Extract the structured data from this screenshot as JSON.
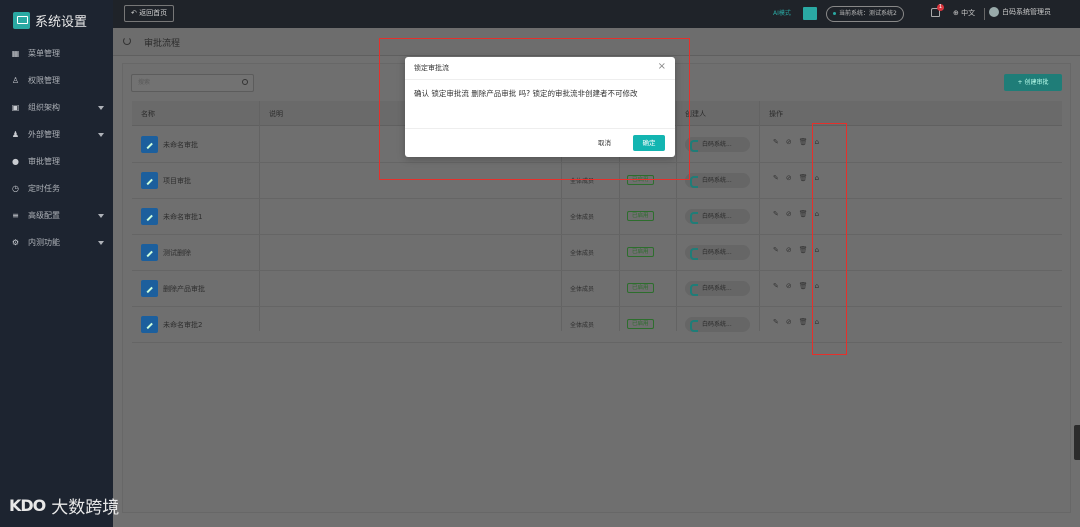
{
  "app": {
    "title": "系统设置"
  },
  "sidebar": {
    "items": [
      {
        "label": "菜单管理",
        "icon": "grid-icon",
        "has_arrow": false
      },
      {
        "label": "权限管理",
        "icon": "user-key-icon",
        "has_arrow": false
      },
      {
        "label": "组织架构",
        "icon": "org-icon",
        "has_arrow": true
      },
      {
        "label": "外部管理",
        "icon": "users-icon",
        "has_arrow": true
      },
      {
        "label": "审批管理",
        "icon": "user-icon",
        "has_arrow": false
      },
      {
        "label": "定时任务",
        "icon": "clock-icon",
        "has_arrow": false
      },
      {
        "label": "高级配置",
        "icon": "sliders-icon",
        "has_arrow": true
      },
      {
        "label": "内测功能",
        "icon": "gear-icon",
        "has_arrow": true
      }
    ]
  },
  "topbar": {
    "back_label": "返回首页",
    "ai_mode": "AI模式",
    "current_system": "当前系统：测试系统2",
    "bell_count": "1",
    "language": "中文",
    "user": "白码系统管理员"
  },
  "crumb": {
    "title": "审批流程"
  },
  "toolbar": {
    "search_placeholder": "搜索",
    "create_label": "+ 创建审批"
  },
  "table": {
    "headers": {
      "name": "名称",
      "desc": "说明",
      "creator": "创建人",
      "ops": "操作"
    },
    "rows": [
      {
        "name": "未命名审批",
        "scope": "全体成员",
        "status": "已启用",
        "creator": "白码系统..."
      },
      {
        "name": "项目审批",
        "scope": "全体成员",
        "status": "已启用",
        "creator": "白码系统..."
      },
      {
        "name": "未命名审批1",
        "scope": "全体成员",
        "status": "已启用",
        "creator": "白码系统..."
      },
      {
        "name": "测试删除",
        "scope": "全体成员",
        "status": "已启用",
        "creator": "白码系统..."
      },
      {
        "name": "删除产品审批",
        "scope": "全体成员",
        "status": "已启用",
        "creator": "白码系统..."
      },
      {
        "name": "未命名审批2",
        "scope": "全体成员",
        "status": "已启用",
        "creator": "白码系统..."
      }
    ]
  },
  "modal": {
    "title": "锁定审批流",
    "body": "确认 锁定审批流 删除产品审批 吗? 锁定的审批流非创建者不可修改",
    "cancel": "取消",
    "ok": "确定"
  },
  "watermark": {
    "logo": "KDO",
    "text": "大数跨境"
  },
  "colors": {
    "accent": "#13b5b1",
    "highlight": "#e5302b",
    "sidebar": "#1d2430"
  }
}
